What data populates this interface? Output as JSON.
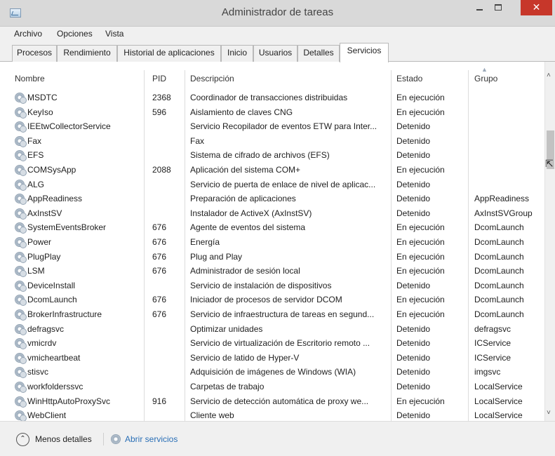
{
  "window": {
    "title": "Administrador de tareas"
  },
  "menu": [
    "Archivo",
    "Opciones",
    "Vista"
  ],
  "tabs": [
    "Procesos",
    "Rendimiento",
    "Historial de aplicaciones",
    "Inicio",
    "Usuarios",
    "Detalles",
    "Servicios"
  ],
  "active_tab": "Servicios",
  "columns": {
    "name": "Nombre",
    "pid": "PID",
    "desc": "Descripción",
    "state": "Estado",
    "group": "Grupo"
  },
  "rows": [
    {
      "name": "MSDTC",
      "pid": "2368",
      "desc": "Coordinador de transacciones distribuidas",
      "state": "En ejecución",
      "group": ""
    },
    {
      "name": "KeyIso",
      "pid": "596",
      "desc": "Aislamiento de claves CNG",
      "state": "En ejecución",
      "group": ""
    },
    {
      "name": "IEEtwCollectorService",
      "pid": "",
      "desc": "Servicio Recopilador de eventos ETW para Inter...",
      "state": "Detenido",
      "group": ""
    },
    {
      "name": "Fax",
      "pid": "",
      "desc": "Fax",
      "state": "Detenido",
      "group": ""
    },
    {
      "name": "EFS",
      "pid": "",
      "desc": "Sistema de cifrado de archivos (EFS)",
      "state": "Detenido",
      "group": ""
    },
    {
      "name": "COMSysApp",
      "pid": "2088",
      "desc": "Aplicación del sistema COM+",
      "state": "En ejecución",
      "group": ""
    },
    {
      "name": "ALG",
      "pid": "",
      "desc": "Servicio de puerta de enlace de nivel de aplicac...",
      "state": "Detenido",
      "group": ""
    },
    {
      "name": "AppReadiness",
      "pid": "",
      "desc": "Preparación de aplicaciones",
      "state": "Detenido",
      "group": "AppReadiness"
    },
    {
      "name": "AxInstSV",
      "pid": "",
      "desc": "Instalador de ActiveX (AxInstSV)",
      "state": "Detenido",
      "group": "AxInstSVGroup"
    },
    {
      "name": "SystemEventsBroker",
      "pid": "676",
      "desc": "Agente de eventos del sistema",
      "state": "En ejecución",
      "group": "DcomLaunch"
    },
    {
      "name": "Power",
      "pid": "676",
      "desc": "Energía",
      "state": "En ejecución",
      "group": "DcomLaunch"
    },
    {
      "name": "PlugPlay",
      "pid": "676",
      "desc": "Plug and Play",
      "state": "En ejecución",
      "group": "DcomLaunch"
    },
    {
      "name": "LSM",
      "pid": "676",
      "desc": "Administrador de sesión local",
      "state": "En ejecución",
      "group": "DcomLaunch"
    },
    {
      "name": "DeviceInstall",
      "pid": "",
      "desc": "Servicio de instalación de dispositivos",
      "state": "Detenido",
      "group": "DcomLaunch"
    },
    {
      "name": "DcomLaunch",
      "pid": "676",
      "desc": "Iniciador de procesos de servidor DCOM",
      "state": "En ejecución",
      "group": "DcomLaunch"
    },
    {
      "name": "BrokerInfrastructure",
      "pid": "676",
      "desc": "Servicio de infraestructura de tareas en segund...",
      "state": "En ejecución",
      "group": "DcomLaunch"
    },
    {
      "name": "defragsvc",
      "pid": "",
      "desc": "Optimizar unidades",
      "state": "Detenido",
      "group": "defragsvc"
    },
    {
      "name": "vmicrdv",
      "pid": "",
      "desc": "Servicio de virtualización de Escritorio remoto ...",
      "state": "Detenido",
      "group": "ICService"
    },
    {
      "name": "vmicheartbeat",
      "pid": "",
      "desc": "Servicio de latido de Hyper-V",
      "state": "Detenido",
      "group": "ICService"
    },
    {
      "name": "stisvc",
      "pid": "",
      "desc": "Adquisición de imágenes de Windows (WIA)",
      "state": "Detenido",
      "group": "imgsvc"
    },
    {
      "name": "workfolderssvc",
      "pid": "",
      "desc": "Carpetas de trabajo",
      "state": "Detenido",
      "group": "LocalService"
    },
    {
      "name": "WinHttpAutoProxySvc",
      "pid": "916",
      "desc": "Servicio de detección automática de proxy we...",
      "state": "En ejecución",
      "group": "LocalService"
    },
    {
      "name": "WebClient",
      "pid": "",
      "desc": "Cliente web",
      "state": "Detenido",
      "group": "LocalService"
    }
  ],
  "footer": {
    "less_details": "Menos detalles",
    "open_services": "Abrir servicios"
  },
  "icons": {
    "app": "task-manager-icon",
    "service": "service-gear-icon",
    "collapse": "chevron-up-circle-icon",
    "open_services": "services-gear-icon"
  },
  "colors": {
    "close_button": "#c7372a",
    "link": "#2a6fb6",
    "titlebar": "#d9d9d9",
    "chrome": "#f0f0f0"
  }
}
